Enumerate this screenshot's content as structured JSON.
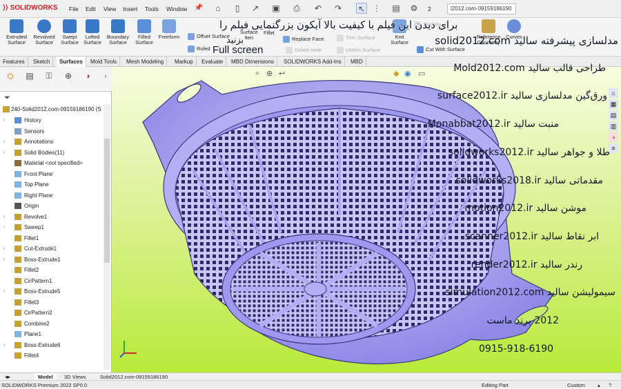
{
  "app": {
    "logo": "SOLIDWORKS",
    "version_badge": "2",
    "search_text": "l2012.com-09159186190"
  },
  "menu": [
    "File",
    "Edit",
    "View",
    "Insert",
    "Tools",
    "Window"
  ],
  "ribbon": {
    "big": [
      {
        "l1": "Extruded",
        "l2": "Surface",
        "color": "#3a79c8"
      },
      {
        "l1": "Revolved",
        "l2": "Surface",
        "color": "#3a79c8"
      },
      {
        "l1": "Swept",
        "l2": "Surface",
        "color": "#3a79c8"
      },
      {
        "l1": "Lofted",
        "l2": "Surface",
        "color": "#3a79c8"
      },
      {
        "l1": "Boundary",
        "l2": "Surface",
        "color": "#3a79c8"
      },
      {
        "l1": "Filled",
        "l2": "Surface",
        "color": "#5a8ed8"
      },
      {
        "l1": "Freeform",
        "l2": "",
        "color": "#7aa3e0"
      }
    ],
    "small": {
      "offset": "Offset Surface",
      "ruled": "Ruled",
      "surface_flatten": "Surface",
      "flatten_sub": "tten",
      "fillet": "Fillet",
      "thicken": "Thicken",
      "replace_face": "Replace Face",
      "delete_hole": "Delete Hole",
      "trim": "Trim Surface",
      "untrim": "Untrim Surface",
      "knit": "Knit",
      "knit_sub": "Surface",
      "cut_with_surface": "Cut With Surface",
      "reference": "Reference",
      "reference_sub": "Geometry",
      "curves": "Curves"
    }
  },
  "tabs": [
    "Features",
    "Sketch",
    "Surfaces",
    "Mold Tools",
    "Mesh Modeling",
    "Markup",
    "Evaluate",
    "MBD Dimensions",
    "SOLIDWORKS Add-Ins",
    "MBD"
  ],
  "active_tab": "Surfaces",
  "tree": {
    "root": "240-Solid2012.com-09159186190 (S",
    "items": [
      {
        "label": "History",
        "arrow": "›",
        "icon": "history"
      },
      {
        "label": "Sensors",
        "arrow": "",
        "icon": "sensor"
      },
      {
        "label": "Annotations",
        "arrow": "›",
        "icon": "annotation"
      },
      {
        "label": "Solid Bodies(11)",
        "arrow": "›",
        "icon": "folder"
      },
      {
        "label": "Material <not specified>",
        "arrow": "",
        "icon": "material"
      },
      {
        "label": "Front Plane",
        "arrow": "",
        "icon": "plane"
      },
      {
        "label": "Top Plane",
        "arrow": "",
        "icon": "plane"
      },
      {
        "label": "Right Plane",
        "arrow": "",
        "icon": "plane"
      },
      {
        "label": "Origin",
        "arrow": "",
        "icon": "origin"
      },
      {
        "label": "Revolve1",
        "arrow": "›",
        "icon": "feature"
      },
      {
        "label": "Sweep1",
        "arrow": "›",
        "icon": "feature"
      },
      {
        "label": "Fillet1",
        "arrow": "",
        "icon": "fillet"
      },
      {
        "label": "Cut-Extrude1",
        "arrow": "›",
        "icon": "cut"
      },
      {
        "label": "Boss-Extrude1",
        "arrow": "›",
        "icon": "feature"
      },
      {
        "label": "Fillet2",
        "arrow": "",
        "icon": "fillet"
      },
      {
        "label": "CirPattern1",
        "arrow": "",
        "icon": "pattern"
      },
      {
        "label": "Boss-Extrude5",
        "arrow": "›",
        "icon": "feature"
      },
      {
        "label": "Fillet3",
        "arrow": "",
        "icon": "fillet"
      },
      {
        "label": "CirPattern2",
        "arrow": "",
        "icon": "pattern"
      },
      {
        "label": "Combine2",
        "arrow": "",
        "icon": "combine"
      },
      {
        "label": "Plane1",
        "arrow": "",
        "icon": "plane"
      },
      {
        "label": "Boss-Extrude6",
        "arrow": "›",
        "icon": "feature"
      },
      {
        "label": "Fillet4",
        "arrow": "",
        "icon": "fillet"
      }
    ]
  },
  "bottom_tabs": [
    "Model",
    "3D Views",
    "Solid2012.com-09159186190"
  ],
  "status": {
    "left": "SOLIDWORKS Premium 2022 SP0.0",
    "mode": "Editing Part",
    "units": "Custom"
  },
  "overlay": {
    "top_line": "برای دیدن این فیلم با کیفیت بالا آیکون بزرگنمایی فیلم را",
    "top_line2": "بزنید",
    "fullscreen": "Full screen",
    "lines": [
      "solid2012.com مدلسازی پیشرفته سالید",
      "طراحی قالب سالید Mold2012.com",
      "ورق‌گین مدلسازی سالید  surface2012.ir",
      "منبت سالید  Monabbat2012.ir",
      "طلا و جواهر سالید  solidworks2012.ir",
      "مقدماتی سالید  solidworks2018.ir",
      "موشن سالید  motion2012.ir",
      "ابر نقاط سالید  scanner2012.ir",
      "رندر سالید  render2012.ir",
      "سیمولیشن سالید  simulation2012.com",
      "2012 برند ماست",
      "0915-918-6190"
    ]
  },
  "colors": {
    "basket": "#a8a4f0",
    "basket_dark": "#3a3680",
    "viewport_bottom": "#b9ea3a",
    "accent_red": "#d0202a"
  }
}
